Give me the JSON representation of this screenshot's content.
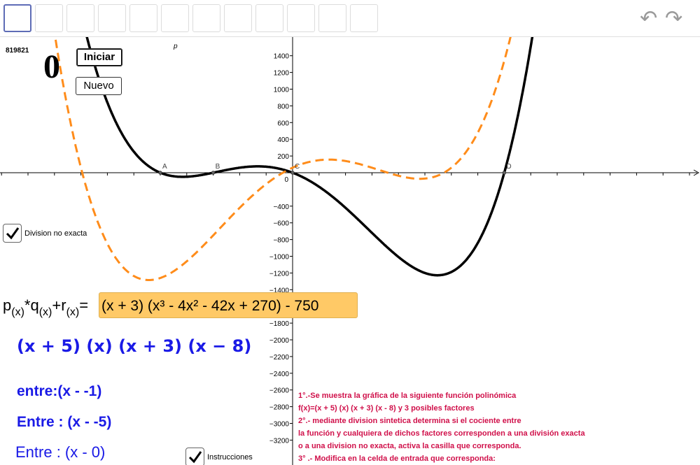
{
  "toolbar": {
    "tool_count": 12,
    "undo_icon": "undo-icon",
    "redo_icon": "redo-icon"
  },
  "counter": {
    "id": "819821",
    "value": "0"
  },
  "buttons": {
    "start_label": "Iniciar",
    "new_label": "Nuevo"
  },
  "checkbox_division": {
    "label": "Division no exacta",
    "checked": true
  },
  "checkbox_instructions": {
    "label": "Instrucciones",
    "checked": true
  },
  "formula": {
    "lhs_p": "p",
    "lhs_q": "q",
    "lhs_r": "r",
    "sub": "(x)",
    "input_value": "(x + 3) (x³ - 4x² - 42x + 270) - 750"
  },
  "factors_text": "(x + 5)  (x)  (x + 3)  (x − 8)",
  "divisor_lines": [
    "entre:(x -  -1)",
    "Entre : (x   -   -5)",
    "Entre : (x   -  0)"
  ],
  "instructions": [
    "1°.-Se muestra la gráfica de la siguiente función polinómica",
    "f(x)=(x + 5) (x) (x + 3) (x - 8)  y 3 posibles factores",
    "2°.- mediante division sintetica determina si el cociente entre",
    " la función y cualquiera de dichos factores corresponden a una división exacta",
    "o a una division no exacta, activa  la casilla que corresponda.",
    "3° .- Modifica en la celda de entrada que corresponda:"
  ],
  "chart_data": {
    "type": "line",
    "y_ticks": [
      1400,
      1200,
      1000,
      800,
      600,
      400,
      200,
      0,
      -400,
      -600,
      -800,
      -1000,
      -1200,
      -1400,
      -1800,
      -2000,
      -2200,
      -2400,
      -2600,
      -2800,
      -3000,
      -3200
    ],
    "points": [
      {
        "label": "A",
        "x": -5,
        "y": 0
      },
      {
        "label": "B",
        "x": -3,
        "y": 0
      },
      {
        "label": "C",
        "x": 0,
        "y": 0
      },
      {
        "label": "D",
        "x": 8,
        "y": 0
      }
    ],
    "function_label": "p",
    "series": [
      {
        "name": "p",
        "expression": "(x + 5)(x)(x + 3)(x - 8)",
        "style": "solid",
        "color": "#000000"
      },
      {
        "name": "",
        "expression": "(x + 3)(x³ - 4x² - 42x + 270) - 750",
        "style": "dashed",
        "color": "#ff8c1a"
      }
    ]
  }
}
